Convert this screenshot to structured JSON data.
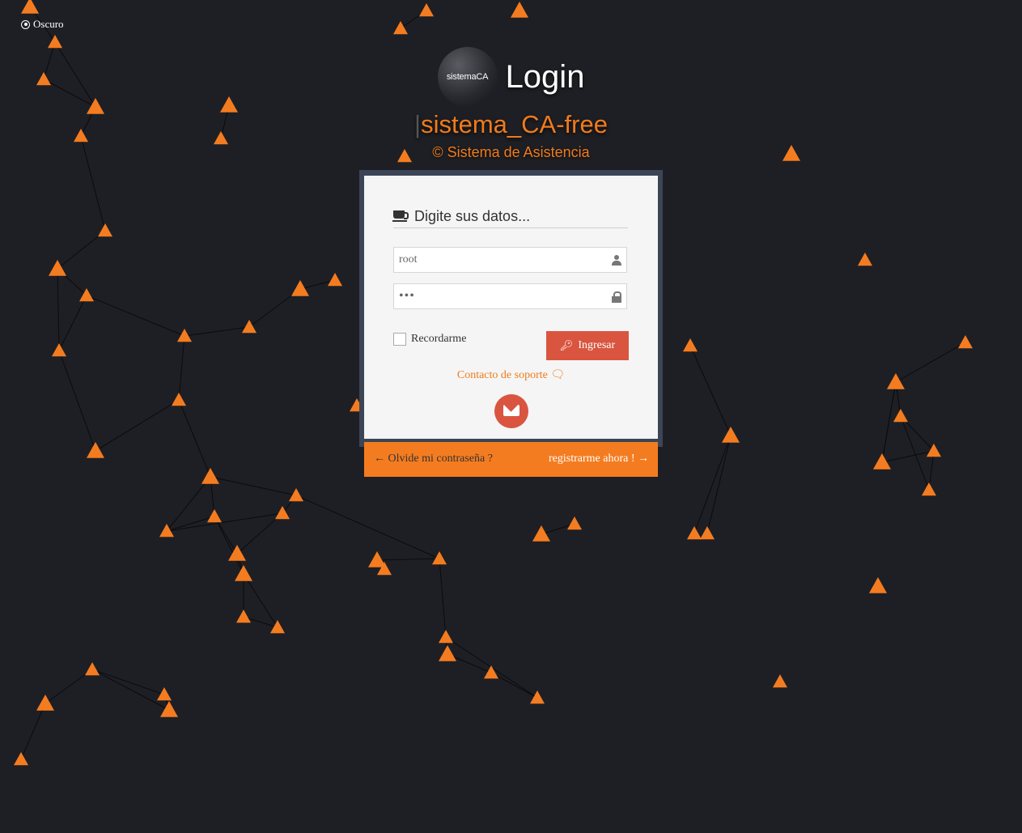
{
  "theme_toggle": {
    "label": "Oscuro",
    "icon": "dot-circle-icon"
  },
  "header": {
    "logo_text": "sistemaCA",
    "title": "Login",
    "app_name": "sistema_CA-free",
    "copyright": "© Sistema de Asistencia"
  },
  "form": {
    "heading": "Digite sus datos...",
    "heading_icon": "coffee-cup-icon",
    "username": {
      "value": "root",
      "icon": "user-icon"
    },
    "password": {
      "value": "•••",
      "icon": "lock-icon"
    },
    "remember_label": "Recordarme",
    "login_button": "Ingresar",
    "support_link": "Contacto de soporte",
    "support_icon": "comments-icon",
    "mail_icon": "envelope-icon"
  },
  "footer": {
    "forgot_password": "Olvide mi contraseña ?",
    "register": "registrarme ahora !"
  },
  "colors": {
    "background": "#1e1f24",
    "accent": "#f47c20",
    "button": "#d9553f",
    "card": "#f5f5f5",
    "card_frame": "#3b4556"
  }
}
